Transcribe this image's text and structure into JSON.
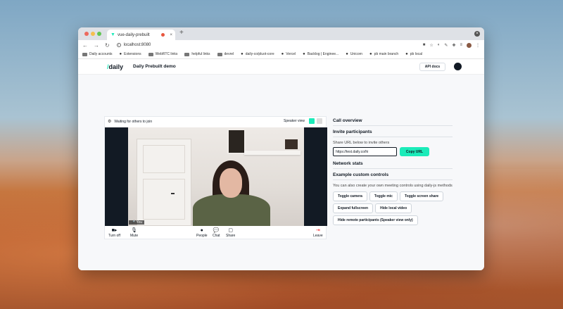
{
  "browser": {
    "tab_title": "vue-daily-prebuilt",
    "tab_close": "×",
    "new_tab": "+",
    "url": "localhost:8080",
    "bookmarks": [
      {
        "label": "Daily accounts",
        "icon": "folder-icon"
      },
      {
        "label": "Extensions",
        "icon": "puzzle-icon"
      },
      {
        "label": "WebRTC links",
        "icon": "folder-icon"
      },
      {
        "label": "helpful links",
        "icon": "folder-icon"
      },
      {
        "label": "devrel",
        "icon": "folder-icon"
      },
      {
        "label": "daily-co/pluot-core",
        "icon": "github-icon"
      },
      {
        "label": "Vercel",
        "icon": "vercel-icon"
      },
      {
        "label": "Backlog | Enginee...",
        "icon": "jira-icon"
      },
      {
        "label": "Unicorn",
        "icon": "unicorn-icon"
      },
      {
        "label": "pb main branch",
        "icon": "daily-icon"
      },
      {
        "label": "pb local",
        "icon": "daily-icon"
      }
    ]
  },
  "header": {
    "logo_slash": "/",
    "logo_text": "daily",
    "title": "Daily Prebuilt demo",
    "api_docs": "API docs"
  },
  "call": {
    "waiting_text": "Waiting for others to join",
    "view_label": "Speaker view",
    "you_label": "You",
    "controls": {
      "turn_off": "Turn off",
      "mute": "Mute",
      "people": "People",
      "chat": "Chat",
      "share": "Share",
      "leave": "Leave"
    }
  },
  "sidebar": {
    "overview_title": "Call overview",
    "invite_title": "Invite participants",
    "invite_helper": "Share URL below to invite others",
    "invite_url": "https://test.daily.co/hi",
    "copy_url": "Copy URL",
    "network_title": "Network stats",
    "controls_title": "Example custom controls",
    "controls_helper": "You can also create your own meeting controls using daily-js methods",
    "buttons": [
      "Toggle camera",
      "Toggle mic",
      "Toggle screen share",
      "Expand fullscreen",
      "Hide local video",
      "Hide remote participants (Speaker view only)"
    ]
  },
  "colors": {
    "accent": "#1bebb9",
    "leave_red": "#f63135",
    "text_dark": "#121a24"
  }
}
